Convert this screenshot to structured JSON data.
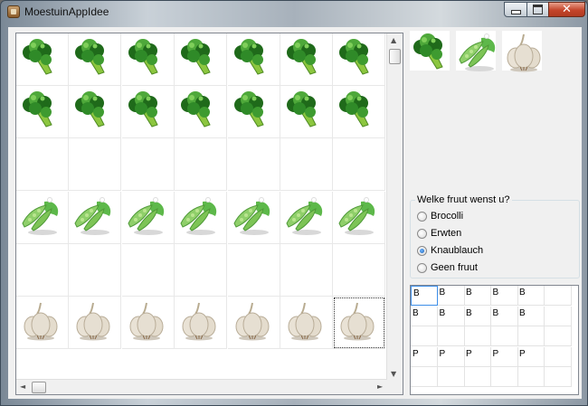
{
  "window": {
    "title": "MoestuinAppIdee"
  },
  "grid": {
    "rows": [
      "broccoli",
      "broccoli",
      "",
      "peas",
      "",
      "garlic"
    ],
    "columns": 7,
    "selected": {
      "row": 5,
      "col": 6
    }
  },
  "thumbnails": [
    "broccoli",
    "peas",
    "garlic"
  ],
  "question": {
    "legend": "Welke fruut wenst u?",
    "options": [
      {
        "label": "Brocolli",
        "checked": false
      },
      {
        "label": "Erwten",
        "checked": false
      },
      {
        "label": "Knaublauch",
        "checked": true
      },
      {
        "label": "Geen fruut",
        "checked": false
      }
    ]
  },
  "table": {
    "columns": 6,
    "rows": [
      [
        "B",
        "B",
        "B",
        "B",
        "B",
        ""
      ],
      [
        "B",
        "B",
        "B",
        "B",
        "B",
        ""
      ],
      [
        "",
        "",
        "",
        "",
        "",
        ""
      ],
      [
        "P",
        "P",
        "P",
        "P",
        "P",
        ""
      ],
      [
        "",
        "",
        "",
        "",
        "",
        ""
      ]
    ]
  },
  "icons": {
    "minimize": "minimize-icon",
    "maximize": "maximize-icon",
    "close": "close-icon",
    "scroll_up": "▲",
    "scroll_down": "▼",
    "scroll_left": "◄",
    "scroll_right": "►",
    "close_glyph": "✕"
  },
  "colors": {
    "broccoli_dark": "#1f6a1a",
    "broccoli_light": "#4ea83a",
    "peas": "#5db84a",
    "garlic": "#e6dfd2"
  }
}
